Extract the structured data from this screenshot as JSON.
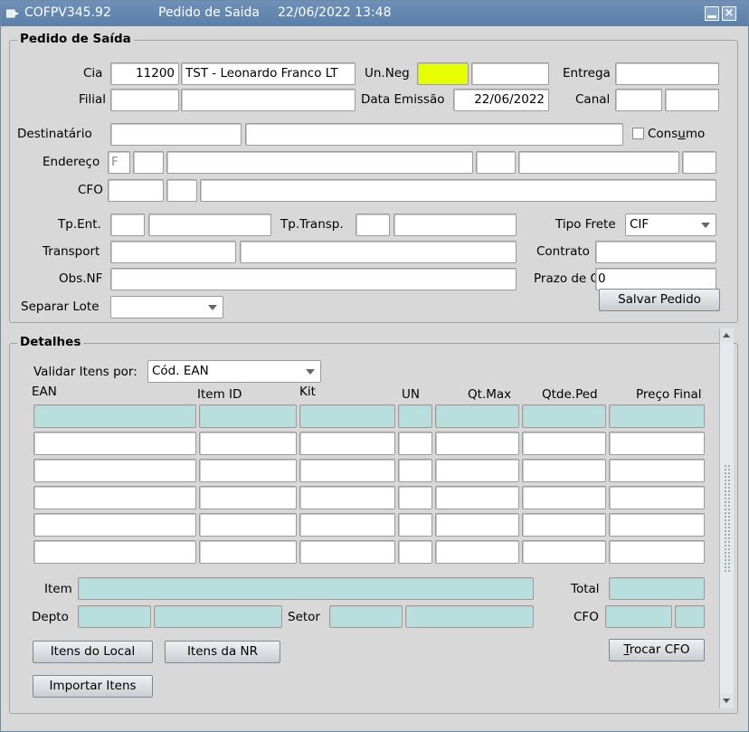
{
  "window": {
    "code": "COFPV345.92",
    "title": "Pedido de Saida",
    "datetime": "22/06/2022 13:48"
  },
  "pedido": {
    "section_title": "Pedido de Saída",
    "cia_label": "Cia",
    "cia_code": "11200",
    "cia_name": "TST - Leonardo Franco LT",
    "unneg_label": "Un.Neg",
    "unneg_value": "",
    "unneg_desc": "",
    "entrega_label": "Entrega",
    "entrega_value": "",
    "filial_label": "Filial",
    "filial_code": "",
    "filial_name": "",
    "data_emissao_label": "Data Emissão",
    "data_emissao_value": "22/06/2022",
    "canal_label": "Canal",
    "canal_code": "",
    "canal_desc": "",
    "destinatario_label": "Destinatário",
    "destinatario_code": "",
    "destinatario_name": "",
    "consumo_label_pre": "Cons",
    "consumo_label_mn": "u",
    "consumo_label_post": "mo",
    "endereco_label": "Endereço",
    "endereco_type": "F",
    "cfo_label": "CFO",
    "tpent_label": "Tp.Ent.",
    "tptransp_label": "Tp.Transp.",
    "tipo_frete_label": "Tipo Frete",
    "tipo_frete_value": "CIF",
    "transport_label": "Transport",
    "contrato_label": "Contrato",
    "obsnf_label": "Obs.NF",
    "prazo_cd_label": "Prazo de CD",
    "prazo_cd_value": "0",
    "separar_lote_label": "Separar Lote",
    "separar_lote_value": "",
    "salvar_label": "Salvar Pedido"
  },
  "detalhes": {
    "section_title": "Detalhes",
    "validar_label": "Validar Itens por:",
    "validar_value": "Cód. EAN",
    "columns": [
      "EAN",
      "Item ID",
      "Kit",
      "UN",
      "Qt.Max",
      "Qtde.Ped",
      "Preço Final"
    ],
    "item_label": "Item",
    "total_label": "Total",
    "depto_label": "Depto",
    "setor_label": "Setor",
    "cfo_label": "CFO",
    "btn_itens_local": "Itens do Local",
    "btn_itens_nr": "Itens da NR",
    "btn_trocar_cfo_mn": "T",
    "btn_trocar_cfo_rest": "rocar CFO",
    "btn_importar": "Importar Itens"
  },
  "icons": {
    "app": "form-window-icon",
    "minimize": "minimize-icon",
    "close": "close-icon"
  }
}
